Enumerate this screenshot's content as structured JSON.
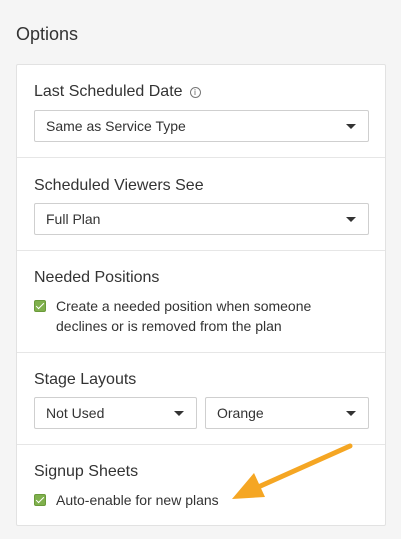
{
  "options": {
    "heading": "Options"
  },
  "sections": {
    "last_scheduled_date": {
      "title": "Last Scheduled Date",
      "select_value": "Same as Service Type"
    },
    "scheduled_viewers_see": {
      "title": "Scheduled Viewers See",
      "select_value": "Full Plan"
    },
    "needed_positions": {
      "title": "Needed Positions",
      "checkbox_label": "Create a needed position when someone declines or is removed from the plan",
      "checked": true
    },
    "stage_layouts": {
      "title": "Stage Layouts",
      "layout_value": "Not Used",
      "color_value": "Orange"
    },
    "signup_sheets": {
      "title": "Signup Sheets",
      "checkbox_label": "Auto-enable for new plans",
      "checked": true
    }
  },
  "icons": {
    "info": "info-icon",
    "dropdown": "chevron-down-icon",
    "annotation_arrow": "arrow-icon"
  },
  "colors": {
    "checkbox": "#7fb04c",
    "arrow": "#f5a623"
  }
}
